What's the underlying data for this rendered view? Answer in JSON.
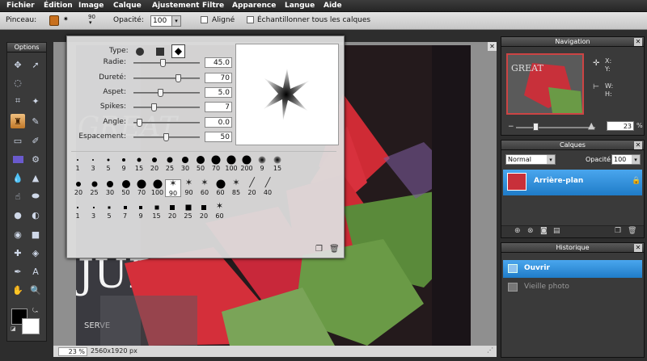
{
  "menu": [
    "Fichier",
    "Édition",
    "Image",
    "Calque",
    "Ajustement",
    "Filtre",
    "Apparence",
    "Langue",
    "Aide"
  ],
  "options_bar": {
    "tool_label": "Pinceau:",
    "brush_size": "90",
    "opacity_label": "Opacité:",
    "opacity_value": "100",
    "aligned_label": "Aligné",
    "sample_label": "Échantillonner tous les calques"
  },
  "tools_panel": {
    "title": "Options"
  },
  "brush_popup": {
    "type_label": "Type:",
    "params": [
      {
        "label": "Radie:",
        "value": "45.0",
        "level": 0.45
      },
      {
        "label": "Dureté:",
        "value": "70",
        "level": 0.7
      },
      {
        "label": "Aspet:",
        "value": "5.0",
        "level": 0.4
      },
      {
        "label": "Spikes:",
        "value": "7",
        "level": 0.3
      },
      {
        "label": "Angle:",
        "value": "0.0",
        "level": 0.05
      },
      {
        "label": "Espacement:",
        "value": "50",
        "level": 0.5
      }
    ],
    "row1": [
      "1",
      "3",
      "5",
      "9",
      "15",
      "20",
      "25",
      "30",
      "50",
      "70",
      "100",
      "200",
      "9",
      "15"
    ],
    "row2": [
      "20",
      "25",
      "30",
      "50",
      "70",
      "100",
      "90",
      "90",
      "60",
      "60",
      "85",
      "20",
      "40"
    ],
    "row3": [
      "1",
      "3",
      "5",
      "7",
      "9",
      "15",
      "20",
      "25",
      "20",
      "60"
    ]
  },
  "navigation": {
    "title": "Navigation",
    "x_label": "X:",
    "y_label": "Y:",
    "w_label": "W:",
    "h_label": "H:",
    "zoom": "23",
    "zoom_unit": "%"
  },
  "layers": {
    "title": "Calques",
    "blend": "Normal",
    "opacity_label": "Opacité:",
    "opacity": "100",
    "layer_name": "Arrière-plan"
  },
  "history": {
    "title": "Historique",
    "items": [
      "Ouvrir",
      "Vieille photo"
    ]
  },
  "status": {
    "zoom": "23",
    "zoom_unit": "%",
    "size": "2560x1920 px"
  },
  "colors": {
    "accent": "#2f8fdc",
    "primary": "#000000",
    "secondary": "#ffffff"
  }
}
